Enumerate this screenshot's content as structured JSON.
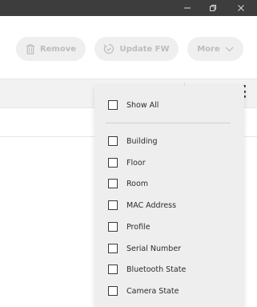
{
  "toolbar": {
    "remove_label": "Remove",
    "update_label": "Update FW",
    "more_label": "More"
  },
  "column_menu": {
    "show_all_label": "Show All",
    "items": [
      {
        "label": "Building",
        "checked": false
      },
      {
        "label": "Floor",
        "checked": false
      },
      {
        "label": "Room",
        "checked": false
      },
      {
        "label": "MAC Address",
        "checked": false
      },
      {
        "label": "Profile",
        "checked": false
      },
      {
        "label": "Serial Number",
        "checked": false
      },
      {
        "label": "Bluetooth State",
        "checked": false
      },
      {
        "label": "Camera State",
        "checked": false
      }
    ]
  },
  "colors": {
    "titlebar": "#3d3d3d",
    "button_bg": "#efefef",
    "button_text_disabled": "#bcbcbc",
    "menu_bg": "#eeeeee",
    "header_bg": "#f2f2f2"
  },
  "icons": {
    "minimize": "minimize-icon",
    "maximize": "restore-icon",
    "close": "close-icon",
    "remove": "trash-icon",
    "update": "refresh-icon",
    "more": "chevron-down-icon",
    "column_options": "kebab-icon"
  }
}
